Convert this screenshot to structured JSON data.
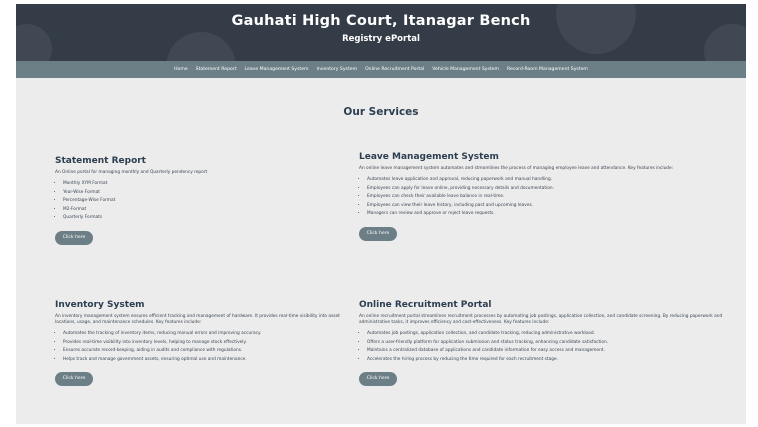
{
  "header": {
    "title": "Gauhati High Court, Itanagar Bench",
    "subtitle": "Registry ePortal"
  },
  "nav": {
    "items": [
      "Home",
      "Statement Report",
      "Leave Management System",
      "Inventory System",
      "Online Recruitment Portal",
      "Vehicle Management System",
      "Record-Room Management System"
    ]
  },
  "main": {
    "heading": "Our Services",
    "cards": [
      {
        "title": "Statement Report",
        "description": "An Online portal for managing monthly and Quarterly pendency report",
        "features": [
          "Monthly XYM Format",
          "Year-Wise Format",
          "Percentage-Wise Format",
          "M2-Format",
          "Quarterly Formats"
        ],
        "button": "Click here"
      },
      {
        "title": "Leave Management System",
        "description": "An online leave management system automates and streamlines the process of managing employee leave and attendance. Key features include:",
        "features": [
          "Automates leave application and approval, reducing paperwork and manual handling.",
          "Employees can apply for leave online, providing necessary details and documentation.",
          "Employees can check their available leave balance in real-time.",
          "Employees can view their leave history, including past and upcoming leaves.",
          "Managers can review and approve or reject leave requests."
        ],
        "button": "Click here"
      },
      {
        "title": "Inventory System",
        "description": "An inventory management system ensures efficient tracking and management of hardware. It provides real-time visibility into asset locations, usage, and maintenance schedules. Key features include:",
        "features": [
          "Automates the tracking of inventory items, reducing manual errors and improving accuracy.",
          "Provides real-time visibility into inventory levels, helping to manage stock effectively.",
          "Ensures accurate record-keeping, aiding in audits and compliance with regulations.",
          "Helps track and manage government assets, ensuring optimal use and maintenance."
        ],
        "button": "Click here"
      },
      {
        "title": "Online Recruitment Portal",
        "description": "An online recruitment portal streamlines recruitment processes by automating job postings, application collection, and candidate screening. By reducing paperwork and administrative tasks, it improves efficiency and cost-effectiveness. Key features include:",
        "features": [
          "Automates job postings, application collection, and candidate tracking, reducing administrative workload.",
          "Offers a user-friendly platform for application submission and status tracking, enhancing candidate satisfaction.",
          "Maintains a centralized database of applications and candidate information for easy access and management.",
          "Accelerates the hiring process by reducing the time required for each recruitment stage."
        ],
        "button": "Click here"
      }
    ]
  }
}
